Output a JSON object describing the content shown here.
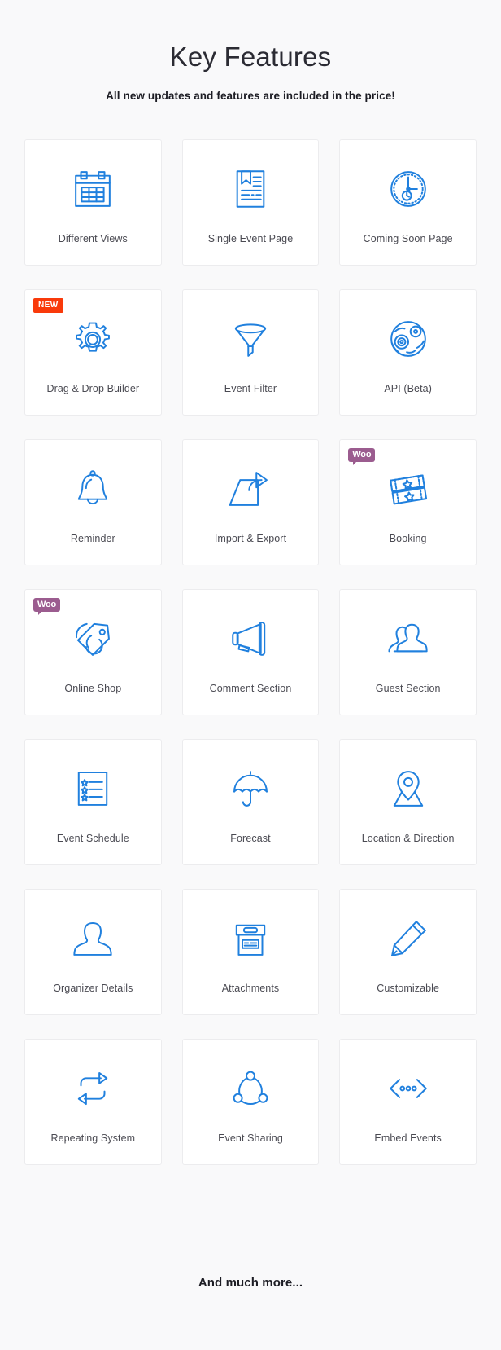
{
  "header": {
    "title": "Key Features",
    "subtitle": "All new updates and features are included in the price!"
  },
  "colors": {
    "page_background": "#f9f9fa",
    "card_background": "#ffffff",
    "card_border": "#ececee",
    "icon_blue": "#2080de",
    "badge_new": "#f93a0b",
    "badge_woo": "#9b5c8f",
    "title_text": "#2b2b33",
    "label_text": "#4a4a52"
  },
  "features": [
    {
      "label": "Different Views",
      "icon": "calendar-icon",
      "badge": null
    },
    {
      "label": "Single Event Page",
      "icon": "document-bookmark-icon",
      "badge": null
    },
    {
      "label": "Coming Soon Page",
      "icon": "clock-icon",
      "badge": null
    },
    {
      "label": "Drag & Drop Builder",
      "icon": "gear-icon",
      "badge": "NEW",
      "badge_type": "new"
    },
    {
      "label": "Event Filter",
      "icon": "funnel-icon",
      "badge": null
    },
    {
      "label": "API (Beta)",
      "icon": "globe-gear-icon",
      "badge": null
    },
    {
      "label": "Reminder",
      "icon": "bell-icon",
      "badge": null
    },
    {
      "label": "Import & Export",
      "icon": "export-arrow-icon",
      "badge": null
    },
    {
      "label": "Booking",
      "icon": "tickets-icon",
      "badge": "Woo",
      "badge_type": "woo"
    },
    {
      "label": "Online Shop",
      "icon": "price-tags-icon",
      "badge": "Woo",
      "badge_type": "woo"
    },
    {
      "label": "Comment Section",
      "icon": "megaphone-icon",
      "badge": null
    },
    {
      "label": "Guest Section",
      "icon": "users-icon",
      "badge": null
    },
    {
      "label": "Event Schedule",
      "icon": "checklist-icon",
      "badge": null
    },
    {
      "label": "Forecast",
      "icon": "umbrella-icon",
      "badge": null
    },
    {
      "label": "Location & Direction",
      "icon": "map-pin-icon",
      "badge": null
    },
    {
      "label": "Organizer Details",
      "icon": "person-icon",
      "badge": null
    },
    {
      "label": "Attachments",
      "icon": "archive-box-icon",
      "badge": null
    },
    {
      "label": "Customizable",
      "icon": "pencil-icon",
      "badge": null
    },
    {
      "label": "Repeating System",
      "icon": "repeat-arrows-icon",
      "badge": null
    },
    {
      "label": "Event Sharing",
      "icon": "share-nodes-icon",
      "badge": null
    },
    {
      "label": "Embed Events",
      "icon": "embed-code-icon",
      "badge": null
    }
  ],
  "footer": {
    "text": "And much more..."
  }
}
